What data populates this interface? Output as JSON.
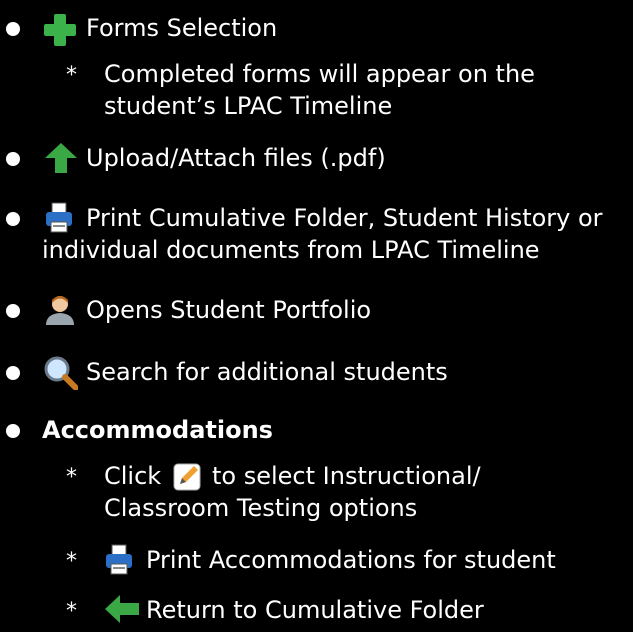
{
  "items": [
    {
      "label": "Forms Selection",
      "icon": "plus-icon"
    },
    {
      "sub_label_line1": "Completed forms will appear on the",
      "sub_label_line2": "student’s LPAC Timeline"
    },
    {
      "label": "Upload/Attach files (.pdf)",
      "icon": "up-arrow-icon"
    },
    {
      "label_line1": "Print Cumulative Folder, Student History or",
      "label_line2": "individual documents from LPAC Timeline",
      "icon": "printer-icon"
    },
    {
      "label": "Opens Student Portfolio",
      "icon": "student-avatar-icon"
    },
    {
      "label": "Search for additional students",
      "icon": "magnifier-icon"
    },
    {
      "label": "Accommodations"
    },
    {
      "click_prefix": "Click",
      "click_suffix": "to select Instructional/",
      "click_line2": "Classroom Testing options",
      "icon": "edit-document-icon"
    },
    {
      "label": "Print Accommodations for student",
      "icon": "printer-icon"
    },
    {
      "label": "Return to Cumulative Folder",
      "icon": "back-arrow-icon"
    }
  ],
  "bullet_symbol": "•",
  "sub_marker": "*",
  "colors": {
    "background": "#000000",
    "text": "#ffffff",
    "plus": "#3bb34a",
    "up_arrow": "#3aa844",
    "back_arrow": "#3aa844",
    "printer": "#2b6fc6"
  }
}
